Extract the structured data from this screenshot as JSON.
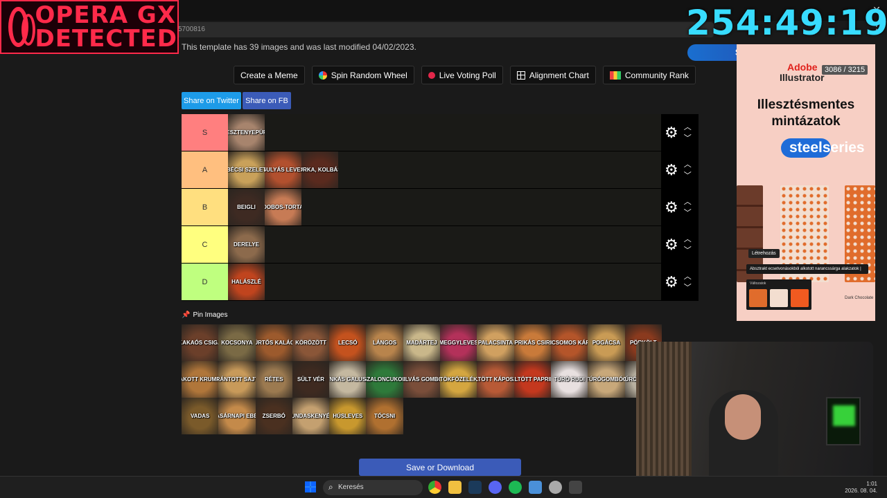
{
  "overlay": {
    "opera_line1": "OPERA GX",
    "opera_line2": "DETECTED",
    "timer": "254:49:19",
    "subpill": "SUBEKORD DÖNTÉS"
  },
  "browser": {
    "address_fragment": "5700816"
  },
  "page": {
    "info": "This template has 39 images and was last modified 04/02/2023.",
    "toolbar": [
      {
        "label": "Create a Meme",
        "icon": ""
      },
      {
        "label": "Spin Random Wheel",
        "icon": "wheel-icon"
      },
      {
        "label": "Live Voting Poll",
        "icon": "record-dot-icon"
      },
      {
        "label": "Alignment Chart",
        "icon": "grid-icon"
      },
      {
        "label": "Community Rank",
        "icon": "color-grid-icon"
      }
    ],
    "share_twitter": "Share on Twitter",
    "share_fb": "Share on FB",
    "pin_images": "Pin Images",
    "save": "Save or Download"
  },
  "tiers": [
    {
      "label": "S",
      "color": "#ff7f7f",
      "items": [
        {
          "text": "GESZTENYEPÜRÉ",
          "color": "#a7846d"
        }
      ]
    },
    {
      "label": "A",
      "color": "#ffbf7f",
      "items": [
        {
          "text": "BÉCSI SZELET",
          "color": "#c9a15a"
        },
        {
          "text": "GULYÁS LEVES",
          "color": "#b2502e"
        },
        {
          "text": "HURKA, KOLBÁSZ",
          "color": "#5a2a1e"
        }
      ]
    },
    {
      "label": "B",
      "color": "#ffdf7f",
      "items": [
        {
          "text": "BEIGLI",
          "color": "#3e2a22"
        },
        {
          "text": "DOBOS-TORTA",
          "color": "#c77b55"
        }
      ]
    },
    {
      "label": "C",
      "color": "#ffff7f",
      "items": [
        {
          "text": "DERELYE",
          "color": "#8c6a4c"
        }
      ]
    },
    {
      "label": "D",
      "color": "#bfff7f",
      "items": [
        {
          "text": "HALÁSZLÉ",
          "color": "#c0441e"
        }
      ]
    }
  ],
  "pool": [
    {
      "text": "KAKAÓS CSIGA",
      "color": "#6b3f2a"
    },
    {
      "text": "KOCSONYA",
      "color": "#7a6a45"
    },
    {
      "text": "KÜRTŐS KALÁCS",
      "color": "#9c5a2d"
    },
    {
      "text": "KÖRÖZÖTT",
      "color": "#8a5638"
    },
    {
      "text": "LECSÓ",
      "color": "#c4521e"
    },
    {
      "text": "LÁNGOS",
      "color": "#b8844c"
    },
    {
      "text": "MADÁRTEJ",
      "color": "#c9b78a"
    },
    {
      "text": "MEGGYLEVES",
      "color": "#b3315a"
    },
    {
      "text": "PALACSINTA",
      "color": "#d0a060"
    },
    {
      "text": "PAPRIKÁS CSIRKE",
      "color": "#c97a3a"
    },
    {
      "text": "PARADICSOMOS KÁPOSZTA",
      "color": "#b4552a"
    },
    {
      "text": "POGÁCSA",
      "color": "#c99b55"
    },
    {
      "text": "PÖRKÖLT",
      "color": "#8a3a1e"
    },
    {
      "text": "RAKOTT KRUMPLI",
      "color": "#b0763a"
    },
    {
      "text": "RÁNTOTT SAJT",
      "color": "#c89a5a"
    },
    {
      "text": "RÉTES",
      "color": "#9c7a50"
    },
    {
      "text": "SÜLT VÉR",
      "color": "#3e2a20"
    },
    {
      "text": "SONKÁS GALUSKA",
      "color": "#c4b8a0"
    },
    {
      "text": "SZALONCUKOR",
      "color": "#2e7a3a"
    },
    {
      "text": "SZILVÁS GOMBÓC",
      "color": "#7a4e3a"
    },
    {
      "text": "TÖKFŐZELÉK",
      "color": "#d4a640"
    },
    {
      "text": "TÖLTÖTT KÁPOSZTA",
      "color": "#b85a36"
    },
    {
      "text": "TÖLTÖTT PAPRIKA",
      "color": "#c4381e"
    },
    {
      "text": "TÚRÓ RUDI",
      "color": "#e8e0e0"
    },
    {
      "text": "TÚRÓGOMBÓC",
      "color": "#c8a87a"
    },
    {
      "text": "TÚRÓS CSUSZA",
      "color": "#b8b0a0"
    },
    {
      "text": "VADAS",
      "color": "#7a5a2a"
    },
    {
      "text": "VASÁRNAPI EBÉD",
      "color": "#c48a4a"
    },
    {
      "text": "ZSERBÓ",
      "color": "#4a3020"
    },
    {
      "text": "ZUNDASKENYÉR",
      "color": "#c4a070"
    },
    {
      "text": "HÚSLEVES",
      "color": "#c8982e"
    },
    {
      "text": "TÓCSNI",
      "color": "#b07030"
    }
  ],
  "ad": {
    "brand": "Adobe",
    "product": "Illustrator",
    "counter": "3086 / 3215",
    "title1": "Illesztésmentes",
    "title2": "mintázatok",
    "sponsor": "steelseries",
    "chip": "Létrehozás",
    "note": "Absztrakt ecsetvonásokból alkotott narancssárga alakzatok |",
    "variants": "Változatok",
    "caption": "Dark Chocolate"
  },
  "taskbar": {
    "search": "Keresés",
    "time": "1:01",
    "date": "2026. 08. 04."
  }
}
